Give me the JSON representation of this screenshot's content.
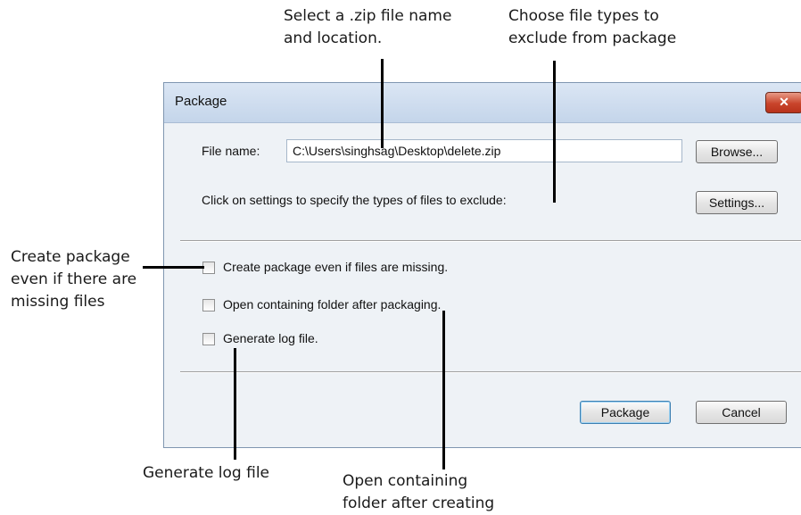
{
  "callouts": {
    "select_zip": "Select a .zip file name\nand location.",
    "exclude_types": "Choose file types to\nexclude from package",
    "create_missing": "Create package\neven if there are\nmissing files",
    "generate_log": "Generate log file",
    "open_folder": "Open containing\nfolder after creating"
  },
  "dialog": {
    "title": "Package",
    "close_glyph": "✕",
    "file_name_label": "File name:",
    "file_name_value": "C:\\Users\\singhsag\\Desktop\\delete.zip",
    "browse_button": "Browse...",
    "settings_text": "Click on settings to specify the types of files to exclude:",
    "settings_button": "Settings...",
    "options": [
      {
        "label": "Create package even if files are missing.",
        "checked": false
      },
      {
        "label": "Open containing folder after packaging.",
        "checked": false
      },
      {
        "label": "Generate log file.",
        "checked": false
      }
    ],
    "package_button": "Package",
    "cancel_button": "Cancel"
  }
}
